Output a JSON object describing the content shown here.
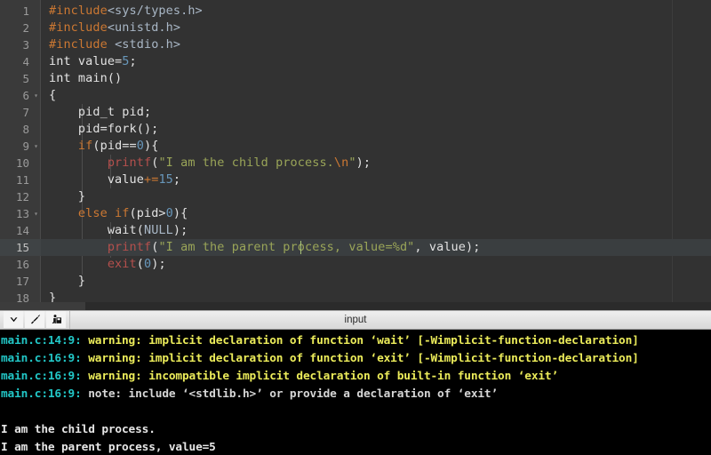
{
  "editor": {
    "line_numbers": [
      "1",
      "2",
      "3",
      "4",
      "5",
      "6",
      "7",
      "8",
      "9",
      "10",
      "11",
      "12",
      "13",
      "14",
      "15",
      "16",
      "17",
      "18"
    ],
    "fold_lines": [
      6,
      9,
      13
    ],
    "current_line": 15,
    "lines": [
      {
        "n": 1,
        "text": "#include<sys/types.h>"
      },
      {
        "n": 2,
        "text": "#include<unistd.h>"
      },
      {
        "n": 3,
        "text": "#include <stdio.h>"
      },
      {
        "n": 4,
        "text": "int value=5;"
      },
      {
        "n": 5,
        "text": "int main()"
      },
      {
        "n": 6,
        "text": "{"
      },
      {
        "n": 7,
        "text": "    pid_t pid;"
      },
      {
        "n": 8,
        "text": "    pid=fork();"
      },
      {
        "n": 9,
        "text": "    if(pid==0){"
      },
      {
        "n": 10,
        "text": "        printf(\"I am the child process.\\n\");"
      },
      {
        "n": 11,
        "text": "        value+=15;"
      },
      {
        "n": 12,
        "text": "    }"
      },
      {
        "n": 13,
        "text": "    else if(pid>0){"
      },
      {
        "n": 14,
        "text": "        wait(NULL);"
      },
      {
        "n": 15,
        "text": "        printf(\"I am the parent process, value=%d\", value);"
      },
      {
        "n": 16,
        "text": "        exit(0);"
      },
      {
        "n": 17,
        "text": "    }"
      },
      {
        "n": 18,
        "text": "}"
      }
    ],
    "tokens": {
      "l1_include": "#include",
      "l1_header": "<sys/types.h>",
      "l2_include": "#include",
      "l2_header": "<unistd.h>",
      "l3_include": "#include",
      "l3_space": " ",
      "l3_header": "<stdio.h>",
      "l4_type": "int",
      "l4_name": " value=",
      "l4_num": "5",
      "l4_semi": ";",
      "l5_type": "int",
      "l5_name": " main()",
      "l6_brace": "{",
      "l7_text": "    pid_t pid;",
      "l8_text": "    pid=fork();",
      "l9_kw": "if",
      "l9_a": "(pid==",
      "l9_num": "0",
      "l9_b": "){",
      "l10_fn": "printf",
      "l10_a": "(",
      "l10_str": "\"I am the child process.",
      "l10_esc": "\\n",
      "l10_str2": "\"",
      "l10_b": ");",
      "l11_a": "        value",
      "l11_op": "+=",
      "l11_num": "15",
      "l11_semi": ";",
      "l12_text": "    }",
      "l13_kw": "else if",
      "l13_a": "(pid>",
      "l13_num": "0",
      "l13_b": "){",
      "l14_a": "        wait(",
      "l14_cst": "NULL",
      "l14_b": ");",
      "l15_fn": "printf",
      "l15_a": "(",
      "l15_str": "\"I am the parent process, value=%d\"",
      "l15_b": ", value);",
      "l16_fn": "exit",
      "l16_a": "(",
      "l16_num": "0",
      "l16_b": ");",
      "l17_text": "    }",
      "l18_text": "}"
    }
  },
  "panel": {
    "title": "input",
    "icons": [
      {
        "name": "chevron-down-icon",
        "glyph": "❯"
      },
      {
        "name": "clear-icon",
        "glyph": "╱"
      },
      {
        "name": "save-icon",
        "glyph": "☰"
      }
    ]
  },
  "terminal": {
    "lines": [
      {
        "type": "warning",
        "location": "main.c:14:9: ",
        "level": "warning: ",
        "message": "implicit declaration of function ‘wait’ [-Wimplicit-function-declaration]"
      },
      {
        "type": "warning",
        "location": "main.c:16:9: ",
        "level": "warning: ",
        "message": "implicit declaration of function ‘exit’ [-Wimplicit-function-declaration]"
      },
      {
        "type": "warning",
        "location": "main.c:16:9: ",
        "level": "warning: ",
        "message": "incompatible implicit declaration of built-in function ‘exit’"
      },
      {
        "type": "note",
        "location": "main.c:16:9: ",
        "level": "note: ",
        "message": "include ‘<stdlib.h>’ or provide a declaration of ‘exit’"
      },
      {
        "type": "blank",
        "text": ""
      },
      {
        "type": "output",
        "text": "I am the child process."
      },
      {
        "type": "output",
        "text": "I am the parent process, value=5"
      }
    ]
  },
  "colors": {
    "editor_bg": "#323232",
    "gutter_bg": "#3a3a3a",
    "terminal_bg": "#000000",
    "toolbar_bg": "#e4e4e4",
    "warning_color": "#ecec5a",
    "location_color": "#22c7c7",
    "output_color": "#e6e6e6"
  }
}
